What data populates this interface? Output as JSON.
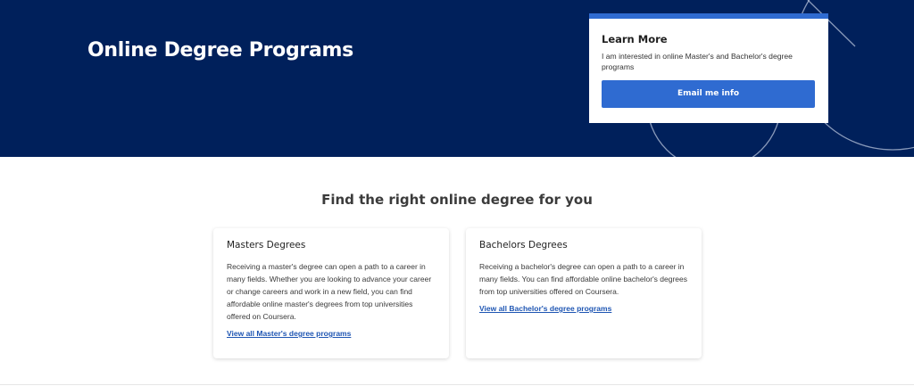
{
  "hero": {
    "title": "Online Degree Programs",
    "background_color": "#00205b"
  },
  "lead_form": {
    "title": "Learn More",
    "description": "I am interested in online Master's and Bachelor's degree programs",
    "button_label": "Email me info",
    "accent_color": "#2f6bd1"
  },
  "section": {
    "heading": "Find the right online degree for you"
  },
  "cards": [
    {
      "title": "Masters Degrees",
      "description": "Receiving a master's degree can open a path to a career in many fields. Whether you are looking to advance your career or change careers and work in a new field, you can find affordable online master's degrees from top universities offered on Coursera.",
      "link": "View all Master's degree programs"
    },
    {
      "title": "Bachelors Degrees",
      "description": "Receiving a bachelor's degree can open a path to a career in many fields. You can find affordable online bachelor's degrees from top universities offered on Coursera.",
      "link": "View all Bachelor's degree programs"
    }
  ],
  "link_color": "#1f56b3"
}
